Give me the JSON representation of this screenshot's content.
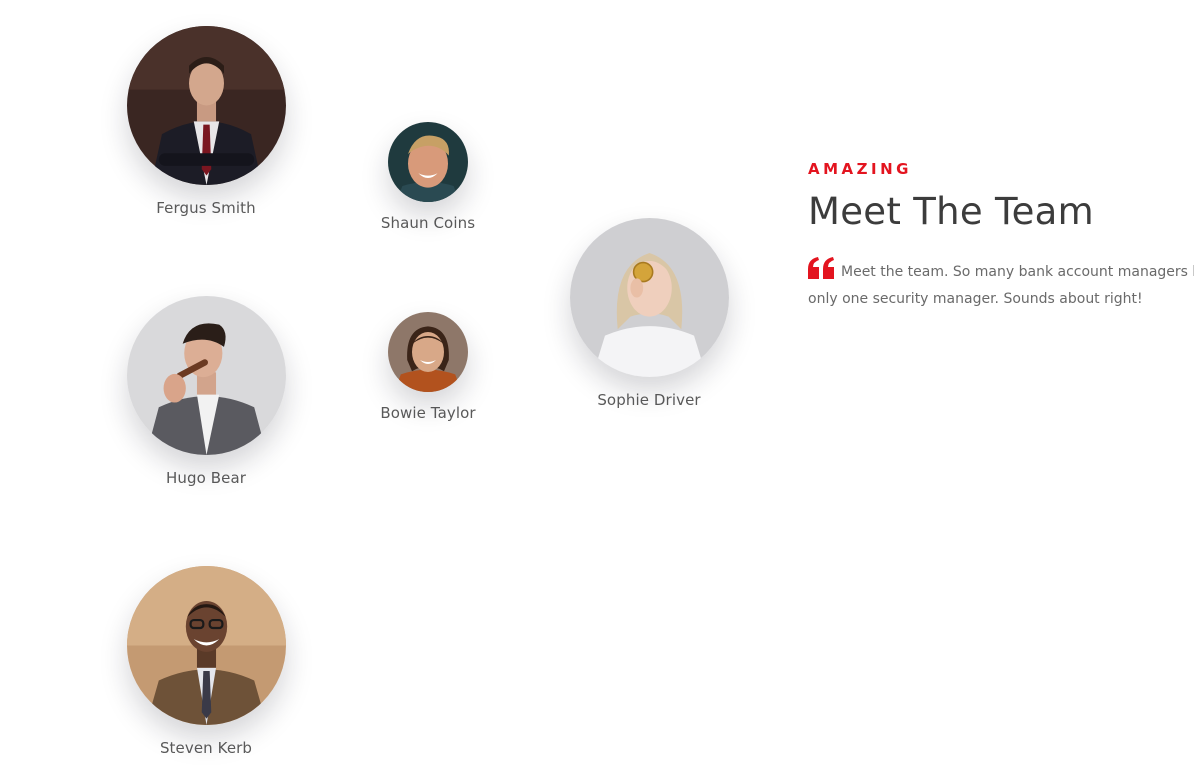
{
  "team": {
    "members": [
      {
        "name": "Fergus Smith"
      },
      {
        "name": "Shaun Coins"
      },
      {
        "name": "Hugo Bear"
      },
      {
        "name": "Bowie Taylor"
      },
      {
        "name": "Sophie Driver"
      },
      {
        "name": "Steven Kerb"
      }
    ]
  },
  "intro": {
    "eyebrow": "AMAZING",
    "title": "Meet The Team",
    "quote_line1": "Meet the team. So many bank account managers bu",
    "quote_line2": "only one security manager. Sounds about right!",
    "quote_icon": "quote-left-icon"
  },
  "colors": {
    "accent": "#e3141f",
    "heading": "#3c3c3c",
    "body_text": "#6a6a6a",
    "name_text": "#5b5b5b"
  }
}
